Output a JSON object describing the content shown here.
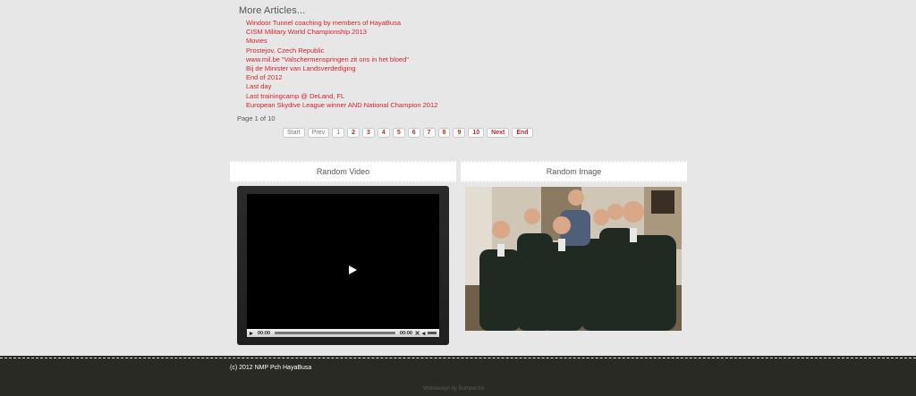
{
  "more_articles": {
    "title": "More Articles...",
    "items": [
      "Windoor Tunnel coaching by members of HayaBusa",
      "CISM Military World Championship 2013",
      "Movies",
      "Prostejov, Czech Republic",
      "www.mil.be \"Valschermenspringen zit ons in het bloed\"",
      "Bij de Minister van Landsverdediging",
      "End of 2012",
      "Last day",
      "Last trainingcamp @ DeLand, FL",
      "European Skydive League winner AND National Champion 2012"
    ]
  },
  "pagination": {
    "info": "Page 1 of 10",
    "start": "Start",
    "prev": "Prev",
    "pages": [
      "1",
      "2",
      "3",
      "4",
      "5",
      "6",
      "7",
      "8",
      "9",
      "10"
    ],
    "next": "Next",
    "end": "End"
  },
  "random_video": {
    "title": "Random Video",
    "time_current": "00:00",
    "time_total": "00:00"
  },
  "random_image": {
    "title": "Random Image"
  },
  "icons": {
    "play": "play-icon",
    "fullscreen": "fullscreen-icon",
    "volume": "volume-icon"
  },
  "footer": {
    "copyright": "(c) 2012 NMP Pch HayaBusa",
    "credit": "Webdesign by Bumper.be"
  }
}
